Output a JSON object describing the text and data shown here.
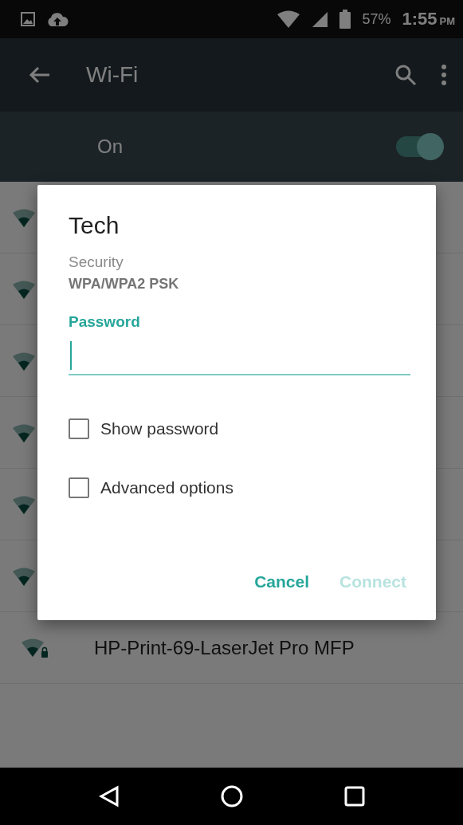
{
  "status_bar": {
    "battery": "57%",
    "time": "1:55",
    "meridiem": "PM"
  },
  "app_bar": {
    "title": "Wi-Fi"
  },
  "master_switch": {
    "label": "On",
    "on": true
  },
  "networks": [
    {
      "kind": "covered"
    },
    {
      "kind": "covered"
    },
    {
      "kind": "covered"
    },
    {
      "kind": "covered"
    },
    {
      "kind": "covered"
    },
    {
      "kind": "covered"
    },
    {
      "kind": "network",
      "name": "HP-Print-69-LaserJet Pro MFP",
      "secured": true
    }
  ],
  "dialog": {
    "title": "Tech",
    "security_label": "Security",
    "security_value": "WPA/WPA2 PSK",
    "password": {
      "label": "Password",
      "focused": true
    },
    "options": [
      {
        "label": "Show password",
        "checked": false
      },
      {
        "label": "Advanced options",
        "checked": false
      }
    ],
    "buttons": [
      {
        "label": "Cancel",
        "disabled": false
      },
      {
        "label": "Connect",
        "disabled": true
      }
    ]
  }
}
